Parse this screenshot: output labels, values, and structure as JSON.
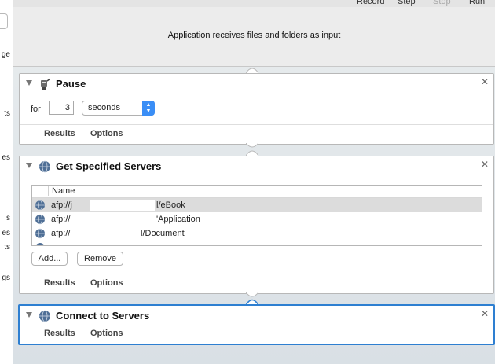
{
  "toolbar": {
    "record_label": "Record",
    "step_label": "Step",
    "stop_label": "Stop",
    "run_label": "Run"
  },
  "left_strip": {
    "fragments": [
      "ge",
      "ts",
      "es",
      "s",
      "es",
      "ts",
      "gs"
    ]
  },
  "workflow": {
    "input_caption": "Application receives files and folders as input"
  },
  "actions": [
    {
      "title": "Pause",
      "results_label": "Results",
      "options_label": "Options",
      "for_label": "for",
      "duration_value": "3",
      "unit_value": "seconds"
    },
    {
      "title": "Get Specified Servers",
      "results_label": "Results",
      "options_label": "Options",
      "column_header": "Name",
      "servers": [
        {
          "prefix": "afp://j",
          "suffix": "l/eBook"
        },
        {
          "prefix": "afp://",
          "suffix": "'Application"
        },
        {
          "prefix": "afp://",
          "suffix": "l/Document"
        }
      ],
      "add_label": "Add...",
      "remove_label": "Remove"
    },
    {
      "title": "Connect to Servers",
      "results_label": "Results",
      "options_label": "Options"
    }
  ],
  "colors": {
    "selection_border": "#2e7fd1",
    "popup_accent": "#3a8ef6"
  }
}
